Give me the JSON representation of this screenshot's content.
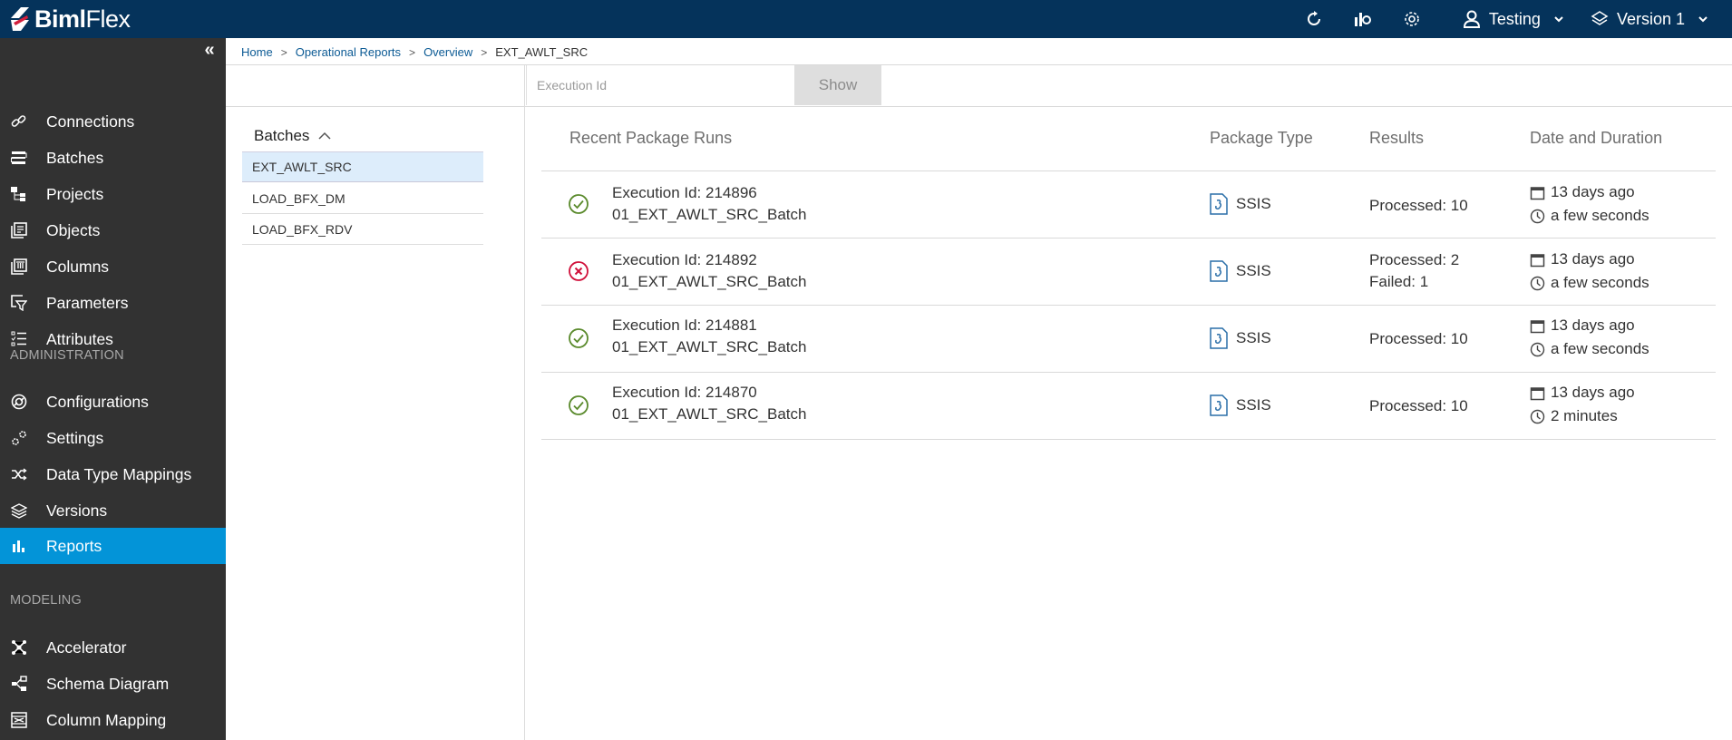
{
  "app": {
    "name_bold": "Biml",
    "name_light": "Flex"
  },
  "topbar": {
    "icons": [
      "refresh-icon",
      "reports-settings-icon",
      "settings-gear-icon"
    ],
    "user": "Testing",
    "version": "Version 1"
  },
  "sidebar": {
    "collapse_label": "«",
    "items": [
      {
        "label": "Connections",
        "icon": "link-icon"
      },
      {
        "label": "Batches",
        "icon": "batches-icon"
      },
      {
        "label": "Projects",
        "icon": "projects-icon"
      },
      {
        "label": "Objects",
        "icon": "objects-icon"
      },
      {
        "label": "Columns",
        "icon": "columns-icon"
      },
      {
        "label": "Parameters",
        "icon": "parameters-icon"
      },
      {
        "label": "Attributes",
        "icon": "attributes-icon"
      }
    ],
    "admin_section": "ADMINISTRATION",
    "admin_items": [
      {
        "label": "Configurations",
        "icon": "configurations-icon"
      },
      {
        "label": "Settings",
        "icon": "settings-icon"
      },
      {
        "label": "Data Type Mappings",
        "icon": "shuffle-icon"
      },
      {
        "label": "Versions",
        "icon": "layers-icon"
      },
      {
        "label": "Reports",
        "icon": "bar-chart-icon",
        "active": true
      }
    ],
    "modeling_section": "MODELING",
    "modeling_items": [
      {
        "label": "Accelerator",
        "icon": "accelerator-icon"
      },
      {
        "label": "Schema Diagram",
        "icon": "schema-diagram-icon"
      },
      {
        "label": "Column Mapping",
        "icon": "column-mapping-icon"
      }
    ]
  },
  "breadcrumb": {
    "items": [
      "Home",
      "Operational Reports",
      "Overview"
    ],
    "current": "EXT_AWLT_SRC"
  },
  "search": {
    "placeholder": "Execution Id",
    "value": "",
    "button": "Show"
  },
  "batches": {
    "header": "Batches",
    "items": [
      "EXT_AWLT_SRC",
      "LOAD_BFX_DM",
      "LOAD_BFX_RDV"
    ],
    "selected": "EXT_AWLT_SRC"
  },
  "runs": {
    "headers": {
      "runs": "Recent Package Runs",
      "type": "Package Type",
      "results": "Results",
      "date": "Date and Duration"
    },
    "rows": [
      {
        "status": "success",
        "execution": "Execution Id: 214896",
        "name": "01_EXT_AWLT_SRC_Batch",
        "type": "SSIS",
        "results": [
          "Processed: 10"
        ],
        "date": "13 days ago",
        "duration": "a few seconds"
      },
      {
        "status": "failed",
        "execution": "Execution Id: 214892",
        "name": "01_EXT_AWLT_SRC_Batch",
        "type": "SSIS",
        "results": [
          "Processed: 2",
          "Failed: 1"
        ],
        "date": "13 days ago",
        "duration": "a few seconds"
      },
      {
        "status": "success",
        "execution": "Execution Id: 214881",
        "name": "01_EXT_AWLT_SRC_Batch",
        "type": "SSIS",
        "results": [
          "Processed: 10"
        ],
        "date": "13 days ago",
        "duration": "a few seconds"
      },
      {
        "status": "success",
        "execution": "Execution Id: 214870",
        "name": "01_EXT_AWLT_SRC_Batch",
        "type": "SSIS",
        "results": [
          "Processed: 10"
        ],
        "date": "13 days ago",
        "duration": "2 minutes"
      }
    ]
  },
  "colors": {
    "topbar": "#05335b",
    "sidebar": "#323232",
    "active": "#0394d8",
    "success": "#5a8a2c",
    "failed": "#d0103a",
    "link": "#0b5a94",
    "selected_batch": "#ddedfb"
  }
}
